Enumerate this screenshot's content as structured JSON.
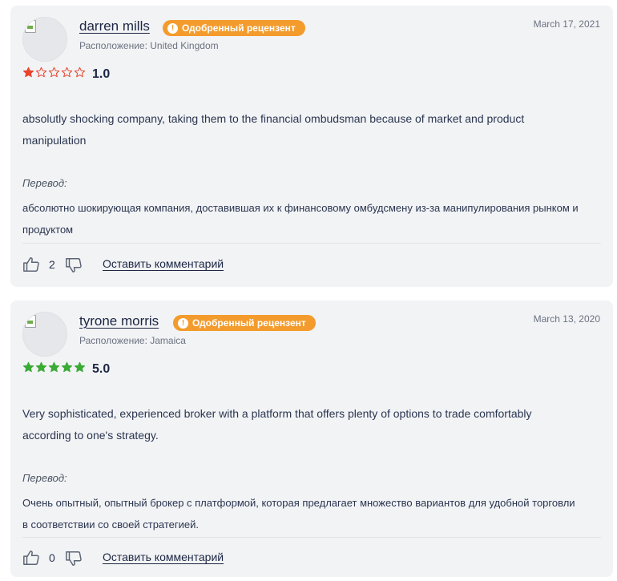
{
  "reviews": [
    {
      "author": "darren mills",
      "badge": "Одобренный рецензент",
      "location": "Расположение: United Kingdom",
      "date": "March 17, 2021",
      "stars": 1,
      "rating": "1.0",
      "star_color": "#e8452c",
      "text": "absolutly shocking company, taking them to the financial ombudsman because of market and product manipulation",
      "translation_label": "Перевод:",
      "translation": "абсолютно шокирующая компания, доставившая их к финансовому омбудсмену из-за манипулирования рынком и продуктом",
      "likes": "2",
      "comment_label": "Оставить комментарий"
    },
    {
      "author": "tyrone morris",
      "badge": "Одобренный рецензент",
      "location": "Расположение: Jamaica",
      "date": "March 13, 2020",
      "stars": 5,
      "rating": "5.0",
      "star_color": "#3aab35",
      "text": "Very sophisticated, experienced broker with a platform that offers plenty of options to trade comfortably according to one's strategy.",
      "translation_label": "Перевод:",
      "translation": "Очень опытный, опытный брокер с платформой, которая предлагает множество вариантов для удобной торговли в соответствии со своей стратегией.",
      "likes": "0",
      "comment_label": "Оставить комментарий"
    }
  ],
  "colors": {
    "badge": "#f39b2c",
    "text": "#1c2643",
    "card": "#f2f3f5"
  },
  "icons": {
    "like": "thumbs-up-icon",
    "dislike": "thumbs-down-icon",
    "badge": "info-icon"
  }
}
